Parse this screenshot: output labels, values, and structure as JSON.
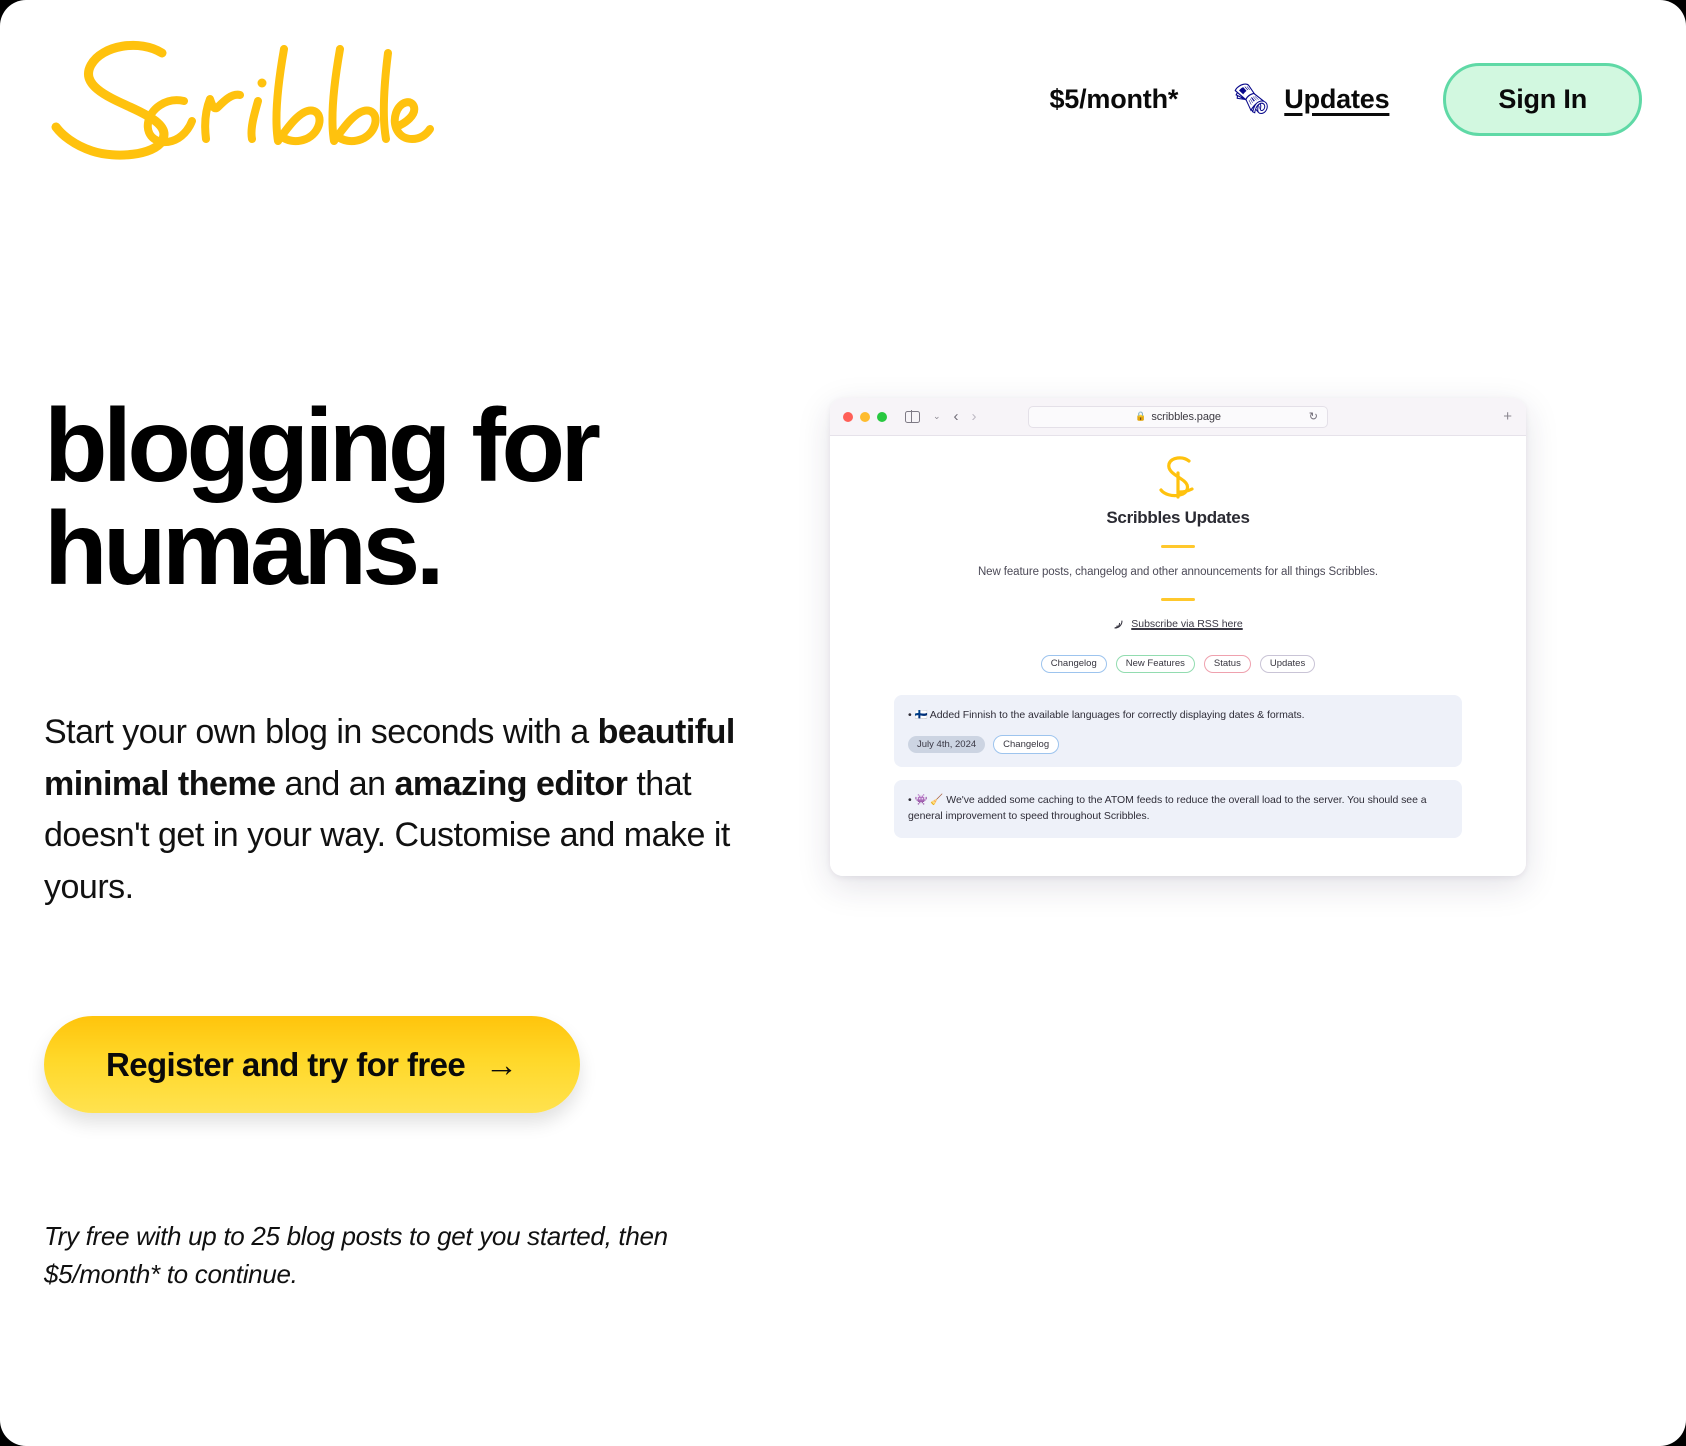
{
  "brand": {
    "logo_text": "Scribbles",
    "logo_color": "#FFC20E"
  },
  "header": {
    "price_label": "$5/month*",
    "updates_emoji": "🗞",
    "updates_label": "Updates",
    "signin_label": "Sign In",
    "signin_bg": "#d2f8e0",
    "signin_border": "#5fd9a6"
  },
  "hero": {
    "title_line1": "blogging for",
    "title_line2": "humans.",
    "sub_part1": "Start your own blog in seconds with a ",
    "sub_bold1": "beautiful minimal theme",
    "sub_part2": " and an ",
    "sub_bold2": "amazing editor",
    "sub_part3": " that doesn't get in your way. Customise and make it yours.",
    "cta_label": "Register and try for free",
    "cta_arrow": "→",
    "cta_gradient_top": "#FFC40C",
    "cta_gradient_bottom": "#FFE24F",
    "footnote": "Try free with up to 25 blog posts to get you started, then $5/month* to continue."
  },
  "browser": {
    "url": "scribbles.page",
    "lock_icon": "lock-icon",
    "reload_icon": "reload-icon",
    "plus_icon": "new-tab-icon",
    "back_arrow": "‹",
    "forward_arrow": "›",
    "chevron": "⌄",
    "page": {
      "site_title": "Scribbles Updates",
      "description": "New feature posts, changelog and other announcements for all things Scribbles.",
      "rss_label": "Subscribe via RSS here",
      "tags": [
        {
          "label": "Changelog",
          "border": "#9dc4ee"
        },
        {
          "label": "New Features",
          "border": "#92dcb0"
        },
        {
          "label": "Status",
          "border": "#efa1ae"
        },
        {
          "label": "Updates",
          "border": "#c9c4d6"
        }
      ],
      "posts": [
        {
          "body": "• 🇫🇮 Added Finnish to the available languages for correctly displaying dates & formats.",
          "date": "July 4th, 2024",
          "tag": "Changelog",
          "tag_border": "#9dc4ee"
        },
        {
          "body": "• 👾 🧹 We've added some caching to the ATOM feeds to reduce the overall load to the server. You should see a general improvement to speed throughout Scribbles.",
          "date": "",
          "tag": "",
          "tag_border": "#9dc4ee"
        }
      ]
    }
  }
}
